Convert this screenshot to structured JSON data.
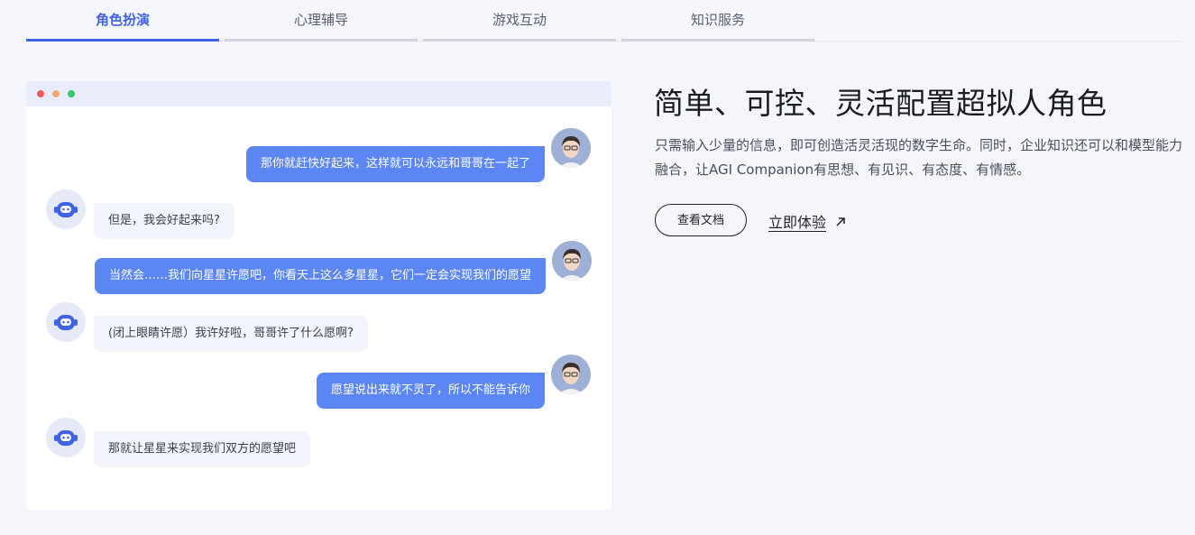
{
  "tabs": [
    {
      "label": "角色扮演",
      "active": true
    },
    {
      "label": "心理辅导",
      "active": false
    },
    {
      "label": "游戏互动",
      "active": false
    },
    {
      "label": "知识服务",
      "active": false
    }
  ],
  "chat": {
    "window_dots": [
      "#f25c5c",
      "#f4a86a",
      "#3ec46d"
    ],
    "messages": [
      {
        "role": "user",
        "text": "那你就赶快好起来，这样就可以永远和哥哥在一起了"
      },
      {
        "role": "bot",
        "text": "但是，我会好起来吗?"
      },
      {
        "role": "user",
        "text": "当然会……我们向星星许愿吧，你看天上这么多星星，它们一定会实现我们的愿望"
      },
      {
        "role": "bot",
        "text": "(闭上眼睛许愿）我许好啦，哥哥许了什么愿啊?"
      },
      {
        "role": "user",
        "text": "愿望说出来就不灵了，所以不能告诉你"
      },
      {
        "role": "bot",
        "text": "那就让星星来实现我们双方的愿望吧"
      }
    ]
  },
  "hero": {
    "title": "简单、可控、灵活配置超拟人角色",
    "description": "只需输入少量的信息，即可创造活灵活现的数字生命。同时，企业知识还可以和模型能力融合，让AGI Companion有思想、有见识、有态度、有情感。",
    "docs_button": "查看文档",
    "try_link": "立即体验",
    "try_icon": "arrow-up-right-icon"
  },
  "colors": {
    "accent": "#3f63e8",
    "user_bubble": "#5b86f3",
    "bot_bubble": "#f3f5fc",
    "page_bg": "#f5f6fc"
  }
}
